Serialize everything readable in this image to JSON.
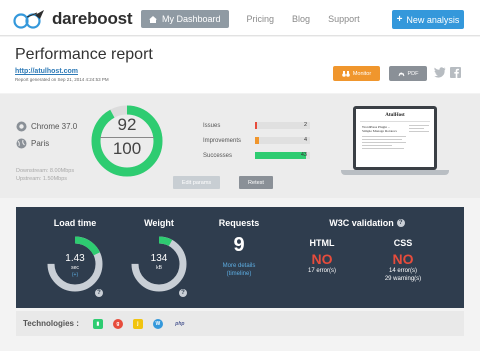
{
  "nav": {
    "brand": "dareboost",
    "dashboard": "My Dashboard",
    "links": [
      "Pricing",
      "Blog",
      "Support"
    ],
    "new_analysis": "New analysis"
  },
  "report": {
    "title": "Performance report",
    "url": "http://atulhost.com",
    "generated": "Report generated on Sep 21, 2014 4:24:53 PM",
    "monitor": "Monitor",
    "pdf": "PDF"
  },
  "stats": {
    "browser": "Chrome 37.0",
    "location": "Paris",
    "downstream": "Downstream: 8.00Mbps",
    "upstream": "Upstream: 1.50Mbps",
    "score": "92",
    "score_max": "100",
    "score_fraction": 0.92,
    "metrics": [
      {
        "label": "Issues",
        "count": "2",
        "fraction": 0.04,
        "color": "#e74c3c"
      },
      {
        "label": "Improvements",
        "count": "4",
        "fraction": 0.07,
        "color": "#f0962d"
      },
      {
        "label": "Successes",
        "count": "43",
        "fraction": 0.93,
        "color": "#2ecc71"
      }
    ],
    "edit_params": "Edit params",
    "retest": "Retest",
    "screenshot_site": "AtulHost",
    "screenshot_heading": "WordPress Plugin – Simple Manage Rotators"
  },
  "dashboard": {
    "load_time": {
      "label": "Load time",
      "value": "1.43",
      "unit": "sec",
      "delta": "(+)",
      "fraction": 0.18
    },
    "weight": {
      "label": "Weight",
      "value": "134",
      "unit": "kB",
      "fraction": 0.08
    },
    "requests": {
      "label": "Requests",
      "value": "9",
      "link": "More details (timeline)"
    },
    "w3c": {
      "label": "W3C validation",
      "html_label": "HTML",
      "html_status": "NO",
      "html_errors": "17 error(s)",
      "css_label": "CSS",
      "css_status": "NO",
      "css_errors": "14 error(s)",
      "css_warnings": "29 warning(s)"
    }
  },
  "technologies": {
    "label": "Technologies :",
    "icons": [
      "google-analytics-icon",
      "google-icon",
      "jquery-icon",
      "wordpress-icon",
      "php-icon"
    ]
  },
  "colors": {
    "accent": "#3498db",
    "success": "#2ecc71",
    "error": "#e74c3c",
    "warning": "#f0962d",
    "dark_panel": "#2f3d4e"
  }
}
